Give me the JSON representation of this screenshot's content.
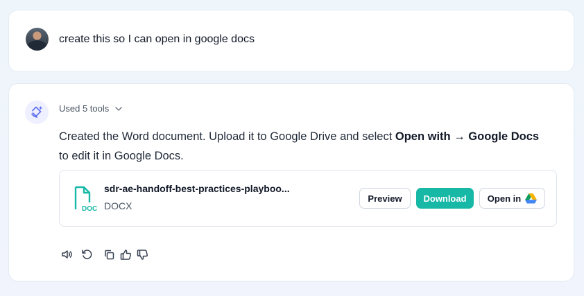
{
  "user_message": {
    "text": "create this so I can open in google docs"
  },
  "assistant": {
    "tools_label": "Used 5 tools",
    "response_part1": "Created the Word document. Upload it to Google Drive and select ",
    "response_bold1": "Open with → Google Docs",
    "response_part2": " to edit it in Google Docs.",
    "file": {
      "name": "sdr-ae-handoff-best-practices-playboo...",
      "type": "DOCX",
      "icon_label": "DOC",
      "preview_label": "Preview",
      "download_label": "Download",
      "open_in_label": "Open in"
    }
  },
  "colors": {
    "accent": "#17b8a6",
    "ai_icon": "#5b6cf0"
  },
  "icons": [
    "avatar",
    "ai-sparkle-icon",
    "chevron-down-icon",
    "doc-file-icon",
    "google-drive-icon",
    "speaker-icon",
    "regenerate-icon",
    "copy-icon",
    "thumbs-up-icon",
    "thumbs-down-icon"
  ]
}
